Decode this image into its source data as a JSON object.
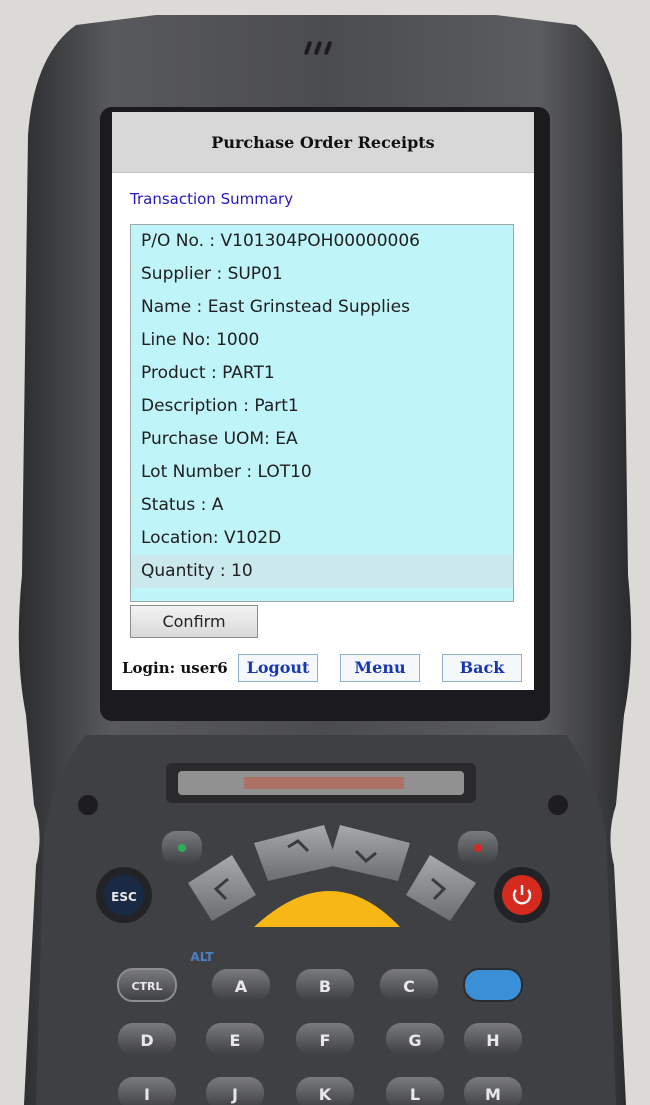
{
  "app": {
    "title": "Purchase Order Receipts"
  },
  "section": {
    "title": "Transaction Summary"
  },
  "summary": {
    "rows": [
      "P/O No. : V101304POH00000006",
      "Supplier : SUP01",
      "Name : East Grinstead Supplies",
      "Line No: 1000",
      "Product : PART1",
      "Description : Part1",
      "Purchase UOM: EA",
      "Lot Number : LOT10",
      "Status : A",
      "Location: V102D",
      "Quantity : 10"
    ]
  },
  "actions": {
    "confirm_label": "Confirm"
  },
  "footer": {
    "login_text": "Login: user6",
    "logout_label": "Logout",
    "menu_label": "Menu",
    "back_label": "Back"
  },
  "device": {
    "keys": {
      "esc": "ESC",
      "alt": "ALT",
      "ctrl": "CTRL",
      "a": "A",
      "b": "B",
      "c": "C",
      "d": "D",
      "e": "E",
      "f": "F",
      "g": "G",
      "h": "H",
      "i": "I",
      "j": "J",
      "k": "K",
      "l": "L",
      "m": "M"
    },
    "colors": {
      "body": "#4b4c4e",
      "trigger": "#f7b816",
      "power": "#d52b1e",
      "blue_key": "#3a8fd6",
      "screen_list": "#bff4f9",
      "link_blue": "#1836b3"
    }
  }
}
